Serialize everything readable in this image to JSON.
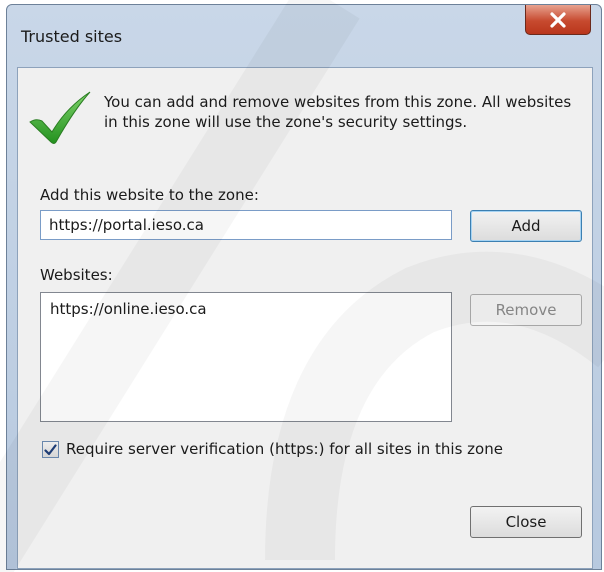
{
  "dialog": {
    "title": "Trusted sites",
    "close_glyph": "X",
    "info_text": "You can add and remove websites from this zone. All websites in this zone will use the zone's security settings.",
    "add_label": "Add this website to the zone:",
    "add_input_value": "https://portal.ieso.ca",
    "add_button": "Add",
    "websites_label": "Websites:",
    "websites": [
      "https://online.ieso.ca"
    ],
    "remove_button": "Remove",
    "require_https_label": "Require server verification (https:) for all sites in this zone",
    "require_https_checked": true,
    "close_button": "Close"
  },
  "icons": {
    "info": "green-checkmark-icon",
    "close": "close-x-icon",
    "checkbox": "checkmark-icon"
  },
  "colors": {
    "checkmark_green": "#2e9e2e",
    "close_red": "#c74a2f",
    "focus_blue": "#3c7fb1"
  }
}
